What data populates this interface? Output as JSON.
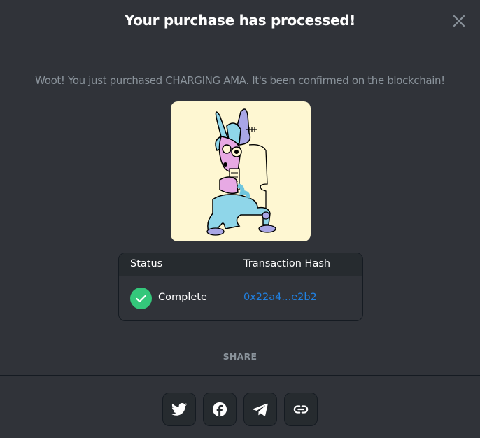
{
  "modal": {
    "title": "Your purchase has processed!",
    "message": "Woot! You just purchased CHARGING AMA. It's been confirmed on the blockchain!",
    "close_icon": "close-icon"
  },
  "nft": {
    "name": "CHARGING AMA",
    "background_color": "#fef7d2"
  },
  "transaction": {
    "columns": [
      "Status",
      "Transaction Hash"
    ],
    "status": "Complete",
    "status_icon": "check-circle-icon",
    "status_color": "#34c77b",
    "hash": "0x22a4...e2b2",
    "hash_color": "#2081e2"
  },
  "share": {
    "label": "SHARE",
    "buttons": [
      {
        "icon": "twitter-icon"
      },
      {
        "icon": "facebook-icon"
      },
      {
        "icon": "telegram-icon"
      },
      {
        "icon": "link-icon"
      }
    ]
  },
  "colors": {
    "background": "#303339",
    "panel": "#262b2f",
    "border": "#151b22",
    "muted_text": "#8a939b"
  }
}
